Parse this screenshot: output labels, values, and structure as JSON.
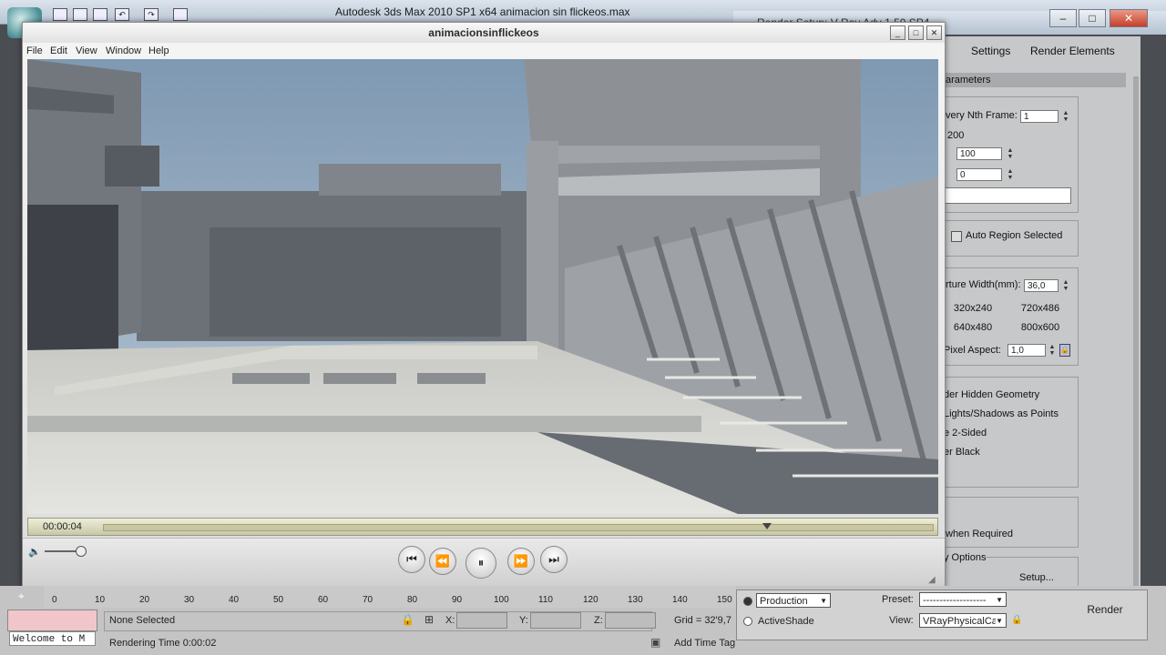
{
  "app": {
    "title": "Autodesk 3ds Max  2010 SP1 x64       animacion sin flickeos.max"
  },
  "render_setup": {
    "title": "Render Setup: V-Ray Adv 1.50.SP4",
    "tabs": [
      "Settings",
      "Render Elements"
    ],
    "rollout_title": "arameters",
    "every_nth_frame_label": "very Nth Frame:",
    "every_nth_frame_value": "1",
    "range_value": "200",
    "field_a": "100",
    "field_b": "0",
    "auto_region_label": "Auto Region Selected",
    "aperture_label": "rture Width(mm):",
    "aperture_value": "36,0",
    "presets": [
      "320x240",
      "720x486",
      "640x480",
      "800x600"
    ],
    "pixel_aspect_label": "Pixel Aspect:",
    "pixel_aspect_value": "1,0",
    "options": [
      "der Hidden Geometry",
      "Lights/Shadows as Points",
      "e 2-Sided",
      "er Black"
    ],
    "when_required": "when Required",
    "y_options": "y Options",
    "setup_button": "Setup..."
  },
  "player": {
    "title": "animacionsinflickeos",
    "menu": [
      "File",
      "Edit",
      "View",
      "Window",
      "Help"
    ],
    "time": "00:00:04",
    "progress_fraction": 0.8
  },
  "timeline": {
    "ticks": [
      "0",
      "10",
      "20",
      "30",
      "40",
      "50",
      "60",
      "70",
      "80",
      "90",
      "100",
      "110",
      "120",
      "130",
      "140",
      "150"
    ]
  },
  "status": {
    "welcome": "Welcome to M",
    "none_selected": "None Selected",
    "rendering_time": "Rendering Time  0:00:02",
    "x_label": "X:",
    "y_label": "Y:",
    "z_label": "Z:",
    "grid": "Grid = 32'9,7",
    "add_time_tag": "Add Time Tag"
  },
  "production": {
    "mode_production": "Production",
    "mode_activeshade": "ActiveShade",
    "preset_label": "Preset:",
    "preset_value": "-------------------",
    "view_label": "View:",
    "view_value": "VRayPhysicalCa",
    "render_button": "Render"
  }
}
